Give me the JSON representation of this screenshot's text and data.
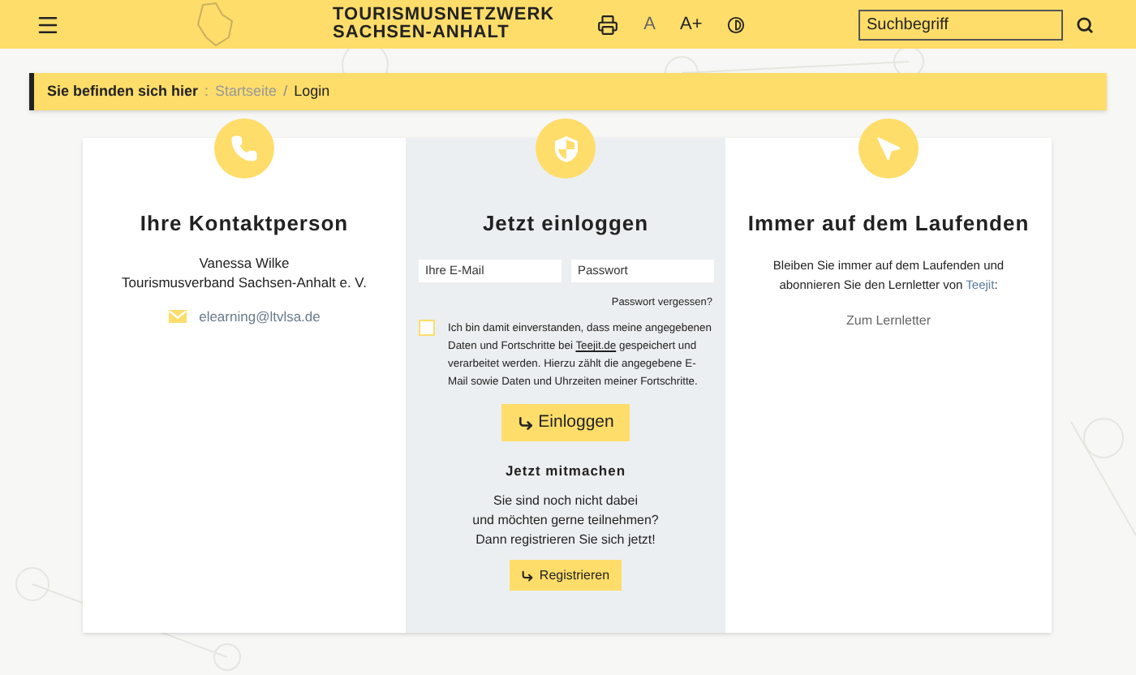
{
  "header": {
    "brand_line_1": "TOURISMUSNETZWERK",
    "brand_line_2": "SACHSEN-ANHALT",
    "font_small": "A",
    "font_large": "A+",
    "search": {
      "placeholder": "Suchbegriff"
    }
  },
  "breadcrumb": {
    "label": "Sie befinden sich hier",
    "separator_1": ":",
    "items": [
      {
        "text": "Startseite",
        "selected": false
      },
      {
        "text": "Login",
        "selected": true
      }
    ],
    "separator_2": "/"
  },
  "contact": {
    "title": "Ihre Kontaktperson",
    "name": "Vanessa Wilke",
    "org": "Tourismusverband Sachsen-Anhalt e. V.",
    "email": "elearning@ltvlsa.de"
  },
  "login": {
    "title": "Jetzt einloggen",
    "email": {
      "placeholder": "Ihre E-Mail"
    },
    "password": {
      "placeholder": "Passwort"
    },
    "forgot": "Passwort vergessen?",
    "consent": {
      "checked": false,
      "before": "Ich bin damit einverstanden, dass meine angegebenen Daten und Fortschritte bei",
      "link": "Teejit.de",
      "after": "gespeichert und verarbeitet werden. Hierzu zählt die angegebene E-Mail sowie Daten und Uhrzeiten meiner Fortschritte."
    },
    "button": "Einloggen",
    "join_title": "Jetzt mitmachen",
    "join_lines": [
      "Sie sind noch nicht dabei",
      "und möchten gerne teilnehmen?",
      "Dann registrieren Sie sich jetzt!"
    ],
    "register": "Registrieren"
  },
  "newsletter": {
    "title": "Immer auf dem Laufenden",
    "before": "Bleiben Sie immer auf dem Laufenden und abonnieren Sie den Lernletter von",
    "link": "Teejit",
    "after": ":",
    "cta": "Zum Lernletter"
  }
}
